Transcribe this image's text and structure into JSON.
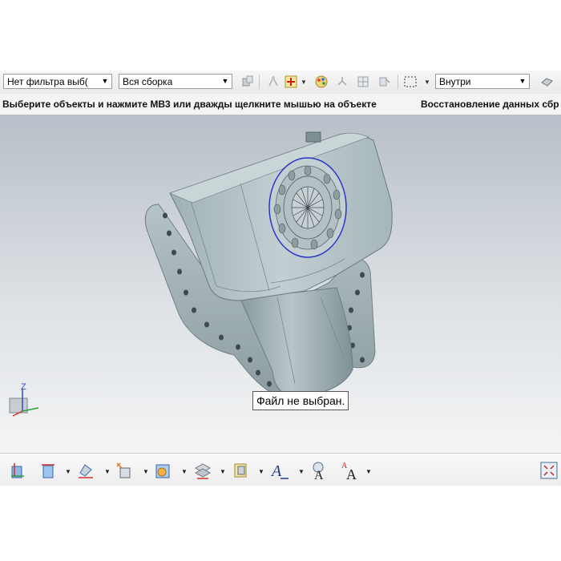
{
  "toolbar": {
    "filter_select": {
      "value": "Нет фильтра выб("
    },
    "scope_select": {
      "value": "Вся сборка"
    },
    "mode_select": {
      "value": "Внутри"
    }
  },
  "cue_line": {
    "prompt": "Выберите объекты и нажмите MB3 или дважды щелкните мышью на объекте",
    "status": "Восстановление данных сбр"
  },
  "viewport": {
    "tooltip": "Файл не выбран.",
    "triad_axis_label": "Z"
  },
  "icons": {
    "top": [
      "assembly-icon",
      "snap-point-icon",
      "select-filter-icon",
      "color-palette-icon",
      "add-component-icon",
      "section-icon",
      "attach-icon",
      "selection-box-icon",
      "shaded-icon"
    ],
    "bottom": [
      "view-triad-icon",
      "section-view-icon",
      "edge-style-icon",
      "move-component-icon",
      "render-icon",
      "layer-icon",
      "object-display-icon",
      "annotation-text-icon",
      "magnifier-text-icon",
      "text-size-icon",
      "fit-view-icon"
    ]
  },
  "colors": {
    "model_body": "#aebcc0",
    "model_shadow": "#7f8e93",
    "viewport_top": "#b7bfc8",
    "selection_edge": "#2a36c8"
  }
}
